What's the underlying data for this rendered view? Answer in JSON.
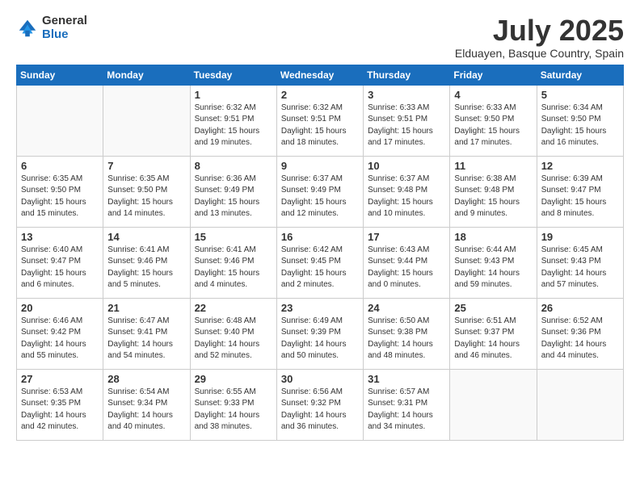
{
  "logo": {
    "general": "General",
    "blue": "Blue"
  },
  "title": {
    "month_year": "July 2025",
    "location": "Elduayen, Basque Country, Spain"
  },
  "weekdays": [
    "Sunday",
    "Monday",
    "Tuesday",
    "Wednesday",
    "Thursday",
    "Friday",
    "Saturday"
  ],
  "weeks": [
    [
      {
        "day": "",
        "info": ""
      },
      {
        "day": "",
        "info": ""
      },
      {
        "day": "1",
        "info": "Sunrise: 6:32 AM\nSunset: 9:51 PM\nDaylight: 15 hours\nand 19 minutes."
      },
      {
        "day": "2",
        "info": "Sunrise: 6:32 AM\nSunset: 9:51 PM\nDaylight: 15 hours\nand 18 minutes."
      },
      {
        "day": "3",
        "info": "Sunrise: 6:33 AM\nSunset: 9:51 PM\nDaylight: 15 hours\nand 17 minutes."
      },
      {
        "day": "4",
        "info": "Sunrise: 6:33 AM\nSunset: 9:50 PM\nDaylight: 15 hours\nand 17 minutes."
      },
      {
        "day": "5",
        "info": "Sunrise: 6:34 AM\nSunset: 9:50 PM\nDaylight: 15 hours\nand 16 minutes."
      }
    ],
    [
      {
        "day": "6",
        "info": "Sunrise: 6:35 AM\nSunset: 9:50 PM\nDaylight: 15 hours\nand 15 minutes."
      },
      {
        "day": "7",
        "info": "Sunrise: 6:35 AM\nSunset: 9:50 PM\nDaylight: 15 hours\nand 14 minutes."
      },
      {
        "day": "8",
        "info": "Sunrise: 6:36 AM\nSunset: 9:49 PM\nDaylight: 15 hours\nand 13 minutes."
      },
      {
        "day": "9",
        "info": "Sunrise: 6:37 AM\nSunset: 9:49 PM\nDaylight: 15 hours\nand 12 minutes."
      },
      {
        "day": "10",
        "info": "Sunrise: 6:37 AM\nSunset: 9:48 PM\nDaylight: 15 hours\nand 10 minutes."
      },
      {
        "day": "11",
        "info": "Sunrise: 6:38 AM\nSunset: 9:48 PM\nDaylight: 15 hours\nand 9 minutes."
      },
      {
        "day": "12",
        "info": "Sunrise: 6:39 AM\nSunset: 9:47 PM\nDaylight: 15 hours\nand 8 minutes."
      }
    ],
    [
      {
        "day": "13",
        "info": "Sunrise: 6:40 AM\nSunset: 9:47 PM\nDaylight: 15 hours\nand 6 minutes."
      },
      {
        "day": "14",
        "info": "Sunrise: 6:41 AM\nSunset: 9:46 PM\nDaylight: 15 hours\nand 5 minutes."
      },
      {
        "day": "15",
        "info": "Sunrise: 6:41 AM\nSunset: 9:46 PM\nDaylight: 15 hours\nand 4 minutes."
      },
      {
        "day": "16",
        "info": "Sunrise: 6:42 AM\nSunset: 9:45 PM\nDaylight: 15 hours\nand 2 minutes."
      },
      {
        "day": "17",
        "info": "Sunrise: 6:43 AM\nSunset: 9:44 PM\nDaylight: 15 hours\nand 0 minutes."
      },
      {
        "day": "18",
        "info": "Sunrise: 6:44 AM\nSunset: 9:43 PM\nDaylight: 14 hours\nand 59 minutes."
      },
      {
        "day": "19",
        "info": "Sunrise: 6:45 AM\nSunset: 9:43 PM\nDaylight: 14 hours\nand 57 minutes."
      }
    ],
    [
      {
        "day": "20",
        "info": "Sunrise: 6:46 AM\nSunset: 9:42 PM\nDaylight: 14 hours\nand 55 minutes."
      },
      {
        "day": "21",
        "info": "Sunrise: 6:47 AM\nSunset: 9:41 PM\nDaylight: 14 hours\nand 54 minutes."
      },
      {
        "day": "22",
        "info": "Sunrise: 6:48 AM\nSunset: 9:40 PM\nDaylight: 14 hours\nand 52 minutes."
      },
      {
        "day": "23",
        "info": "Sunrise: 6:49 AM\nSunset: 9:39 PM\nDaylight: 14 hours\nand 50 minutes."
      },
      {
        "day": "24",
        "info": "Sunrise: 6:50 AM\nSunset: 9:38 PM\nDaylight: 14 hours\nand 48 minutes."
      },
      {
        "day": "25",
        "info": "Sunrise: 6:51 AM\nSunset: 9:37 PM\nDaylight: 14 hours\nand 46 minutes."
      },
      {
        "day": "26",
        "info": "Sunrise: 6:52 AM\nSunset: 9:36 PM\nDaylight: 14 hours\nand 44 minutes."
      }
    ],
    [
      {
        "day": "27",
        "info": "Sunrise: 6:53 AM\nSunset: 9:35 PM\nDaylight: 14 hours\nand 42 minutes."
      },
      {
        "day": "28",
        "info": "Sunrise: 6:54 AM\nSunset: 9:34 PM\nDaylight: 14 hours\nand 40 minutes."
      },
      {
        "day": "29",
        "info": "Sunrise: 6:55 AM\nSunset: 9:33 PM\nDaylight: 14 hours\nand 38 minutes."
      },
      {
        "day": "30",
        "info": "Sunrise: 6:56 AM\nSunset: 9:32 PM\nDaylight: 14 hours\nand 36 minutes."
      },
      {
        "day": "31",
        "info": "Sunrise: 6:57 AM\nSunset: 9:31 PM\nDaylight: 14 hours\nand 34 minutes."
      },
      {
        "day": "",
        "info": ""
      },
      {
        "day": "",
        "info": ""
      }
    ]
  ]
}
